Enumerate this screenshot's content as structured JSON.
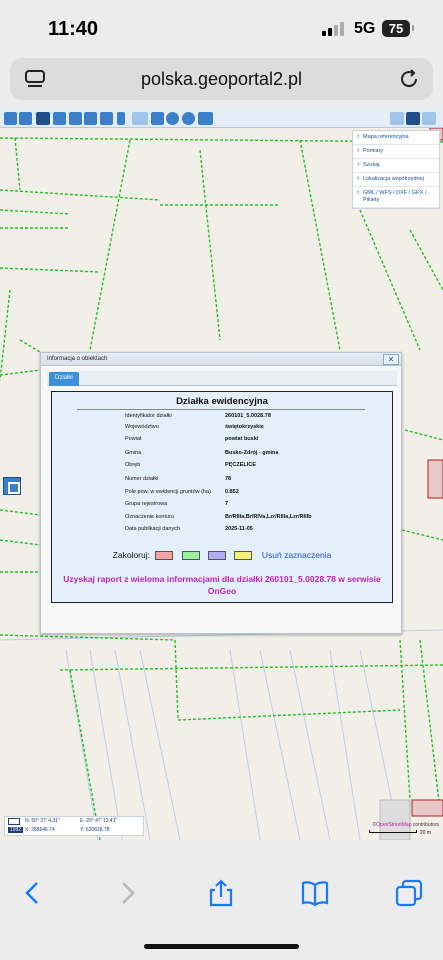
{
  "status_bar": {
    "time": "11:40",
    "network": "5G",
    "battery": "75"
  },
  "browser": {
    "url": "polska.geoportal2.pl"
  },
  "side_menu": {
    "items": [
      "Mapa referencyjna",
      "Pomiary",
      "Szukaj",
      "Lokalizacja współrzędnej",
      "GML / WFS / DXF / GPX / Pikiety"
    ]
  },
  "dialog": {
    "title": "Informacja o obiektach",
    "close_label": "✕",
    "tab": "Działki",
    "heading": "Działka ewidencyjna",
    "rows": [
      {
        "label": "Identyfikator działki",
        "value": "260101_5.0028.78"
      },
      {
        "label": "Województwo",
        "value": "świętokrzyskie"
      },
      {
        "label": "Powiat",
        "value": "powiat buski"
      },
      {
        "label": "Gmina",
        "value": "Busko-Zdrój - gmina"
      },
      {
        "label": "Obręb",
        "value": "PĘCZELICE"
      },
      {
        "label": "Numer działki",
        "value": "78"
      },
      {
        "label": "Pole pow. w ewidencji gruntów (ha)",
        "value": "0.852"
      },
      {
        "label": "Grupa rejestrowa",
        "value": "7"
      },
      {
        "label": "Oznaczenie konturu",
        "value": "Br/RIIIa,Br/RIVa,Lzr/RIIIa,Lzr/RIIIb"
      },
      {
        "label": "Data publikacji danych",
        "value": "2025-11-05"
      }
    ],
    "color_label": "Zakoloruj:",
    "swatch_colors": [
      "#f4a4a4",
      "#9ff09f",
      "#b3aef2",
      "#f2f27a"
    ],
    "clear_label": "Usuń zaznaczenia",
    "promo_text": "Uzyskaj raport z wieloma informacjami dla działki 260101_5.0028.78 w serwisie OnGeo"
  },
  "map_footer": {
    "n_coord": "N: 50° 27' 4.31\"",
    "e_coord": "E: 20° 47' 13.41\"",
    "epsg": "1992",
    "x_coord": "X: 288646.74",
    "y_coord": "Y: 620828.78",
    "attribution_prefix": "©",
    "attribution_link": "OpenStreetMap",
    "attribution_suffix": " contributors",
    "scale": "20 m"
  },
  "colors": {
    "parcel_line": "#22c022",
    "map_bg": "#f2efe9",
    "road": "#c8d8f0"
  }
}
